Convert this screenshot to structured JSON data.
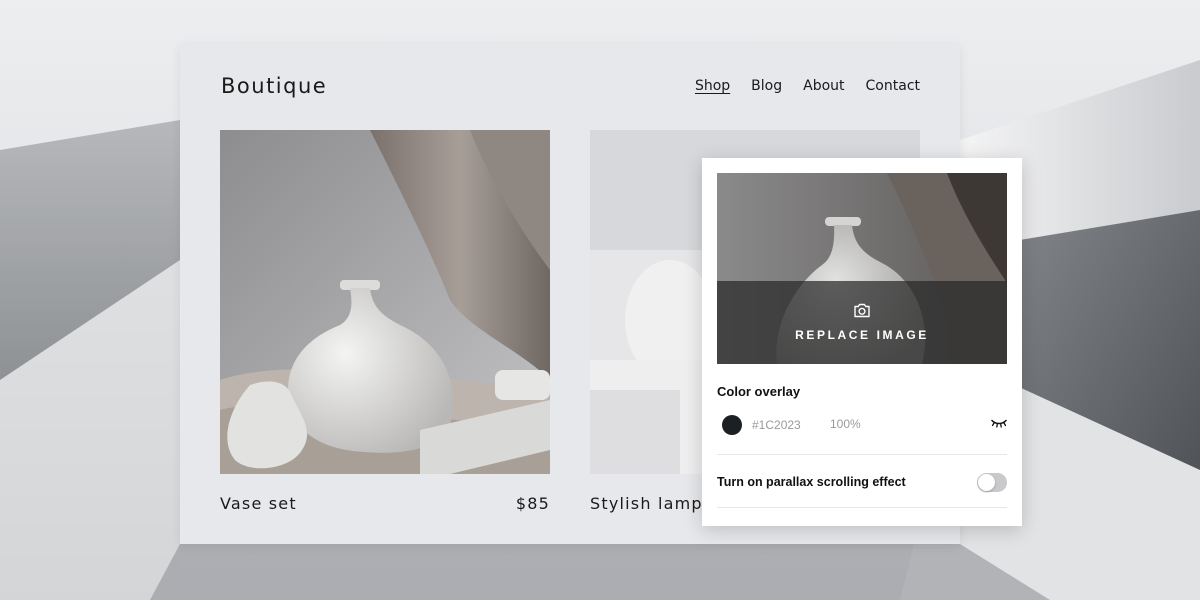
{
  "site": {
    "brand": "Boutique",
    "nav": [
      "Shop",
      "Blog",
      "About",
      "Contact"
    ],
    "active_nav": "Shop"
  },
  "products": [
    {
      "name": "Vase set",
      "price": "$85"
    },
    {
      "name": "Stylish lamp",
      "price": ""
    }
  ],
  "panel": {
    "replace_label": "REPLACE IMAGE",
    "replace_icon": "camera-icon",
    "color_overlay_title": "Color overlay",
    "color_hex": "#1C2023",
    "color_swatch": "#1c2023",
    "opacity": "100%",
    "visibility_icon": "eye-closed-icon",
    "parallax_label": "Turn on parallax scrolling effect",
    "parallax_on": false
  }
}
